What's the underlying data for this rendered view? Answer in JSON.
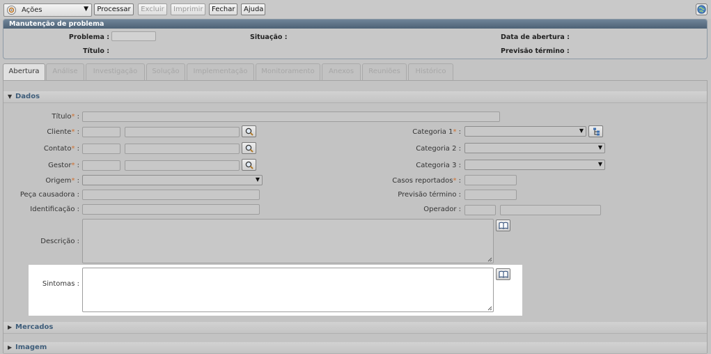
{
  "toolbar": {
    "actions_label": "Ações",
    "buttons": [
      "Processar",
      "Excluir",
      "Imprimir",
      "Fechar",
      "Ajuda"
    ]
  },
  "header": {
    "title": "Manutenção de problema",
    "problema_label": "Problema :",
    "situacao_label": "Situação :",
    "data_abertura_label": "Data de abertura :",
    "titulo_label": "Título :",
    "previsao_label": "Previsão término :"
  },
  "tabs": [
    "Abertura",
    "Análise",
    "Investigação",
    "Solução",
    "Implementação",
    "Monitoramento",
    "Anexos",
    "Reuniões",
    "Histórico"
  ],
  "sections": {
    "dados": "Dados",
    "mercados": "Mercados",
    "imagem": "Imagem"
  },
  "form": {
    "titulo": "Título",
    "cliente": "Cliente",
    "contato": "Contato",
    "gestor": "Gestor",
    "origem": "Origem",
    "peca": "Peça causadora :",
    "identificacao": "Identificação :",
    "descricao": "Descrição :",
    "sintomas": "Sintomas :",
    "categoria1": "Categoria 1",
    "categoria2": "Categoria 2 :",
    "categoria3": "Categoria 3 :",
    "casos": "Casos reportados",
    "previsao": "Previsão término :",
    "operador": "Operador :"
  },
  "req_mark": "*",
  "sep": " :",
  "colors": {
    "header_bar": "#5a6f84",
    "section_title": "#3e5d7a",
    "required": "#d06f2e"
  },
  "icons": [
    "gear-icon",
    "dropdown-arrow-icon",
    "globe-icon",
    "search-icon",
    "tree-icon",
    "book-icon",
    "collapse-icon",
    "expand-icon"
  ]
}
